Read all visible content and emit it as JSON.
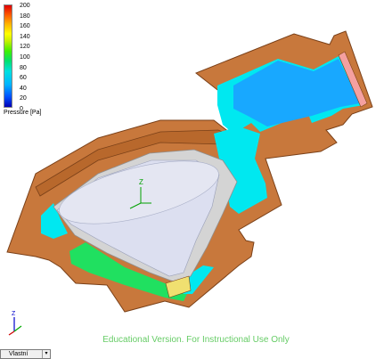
{
  "legend": {
    "title": "Pressure [Pa]",
    "ticks": [
      "200",
      "180",
      "160",
      "140",
      "120",
      "100",
      "80",
      "60",
      "40",
      "20",
      "0"
    ]
  },
  "watermark": "Educational Version. For Instructional Use Only",
  "view_selector": {
    "value": "Vlastní"
  },
  "triad": {
    "z": "Z"
  },
  "model_triad": {
    "z": "Z"
  },
  "colors": {
    "housing": "#c8783c",
    "housing_dark": "#8a4a1e",
    "fluid_cyan": "#00e8f0",
    "fluid_blue": "#0090ff",
    "fluid_green": "#20e060",
    "cone": "#d8dcea",
    "shell": "#d4d4d4",
    "outlet_face": "#f5a0a0"
  }
}
